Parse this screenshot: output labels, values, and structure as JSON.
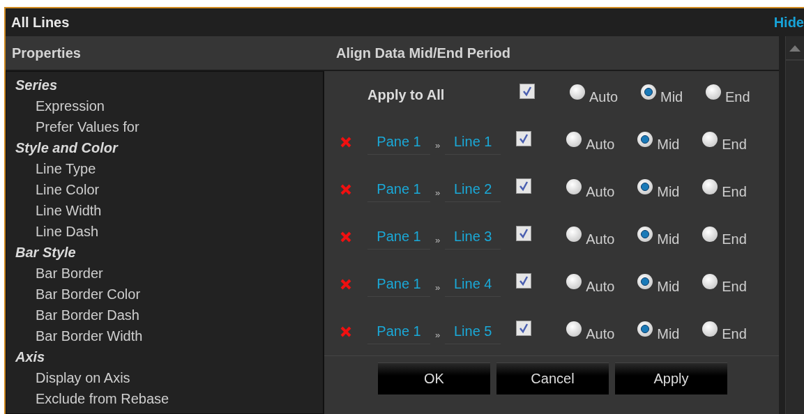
{
  "window": {
    "title": "All Lines",
    "hide_link": "Hide"
  },
  "properties": {
    "title": "Properties",
    "groups": [
      {
        "label": "Series",
        "children": [
          {
            "label": "Expression"
          },
          {
            "label": "Prefer Values for"
          }
        ]
      },
      {
        "label": "Style and Color",
        "children": [
          {
            "label": "Line Type"
          },
          {
            "label": "Line Color"
          },
          {
            "label": "Line Width"
          },
          {
            "label": "Line Dash"
          }
        ]
      },
      {
        "label": "Bar Style",
        "children": [
          {
            "label": "Bar Border"
          },
          {
            "label": "Bar Border Color"
          },
          {
            "label": "Bar Border Dash"
          },
          {
            "label": "Bar Border Width"
          }
        ]
      },
      {
        "label": "Axis",
        "children": [
          {
            "label": "Display on Axis"
          },
          {
            "label": "Exclude from Rebase"
          }
        ]
      }
    ]
  },
  "panel": {
    "title": "Align Data Mid/End Period",
    "apply_all": {
      "label": "Apply to All",
      "checked": true,
      "options": [
        {
          "label": "Auto",
          "selected": false
        },
        {
          "label": "Mid",
          "selected": true
        },
        {
          "label": "End",
          "selected": false
        }
      ]
    },
    "rows": [
      {
        "pane": "Pane 1",
        "separator": "»",
        "line": "Line 1",
        "checked": true,
        "options": [
          {
            "label": "Auto",
            "selected": false
          },
          {
            "label": "Mid",
            "selected": true
          },
          {
            "label": "End",
            "selected": false
          }
        ]
      },
      {
        "pane": "Pane 1",
        "separator": "»",
        "line": "Line 2",
        "checked": true,
        "options": [
          {
            "label": "Auto",
            "selected": false
          },
          {
            "label": "Mid",
            "selected": true
          },
          {
            "label": "End",
            "selected": false
          }
        ]
      },
      {
        "pane": "Pane 1",
        "separator": "»",
        "line": "Line 3",
        "checked": true,
        "options": [
          {
            "label": "Auto",
            "selected": false
          },
          {
            "label": "Mid",
            "selected": true
          },
          {
            "label": "End",
            "selected": false
          }
        ]
      },
      {
        "pane": "Pane 1",
        "separator": "»",
        "line": "Line 4",
        "checked": true,
        "options": [
          {
            "label": "Auto",
            "selected": false
          },
          {
            "label": "Mid",
            "selected": true
          },
          {
            "label": "End",
            "selected": false
          }
        ]
      },
      {
        "pane": "Pane 1",
        "separator": "»",
        "line": "Line 5",
        "checked": true,
        "options": [
          {
            "label": "Auto",
            "selected": false
          },
          {
            "label": "Mid",
            "selected": true
          },
          {
            "label": "End",
            "selected": false
          }
        ]
      }
    ],
    "buttons": [
      "OK",
      "Cancel",
      "Apply"
    ]
  }
}
